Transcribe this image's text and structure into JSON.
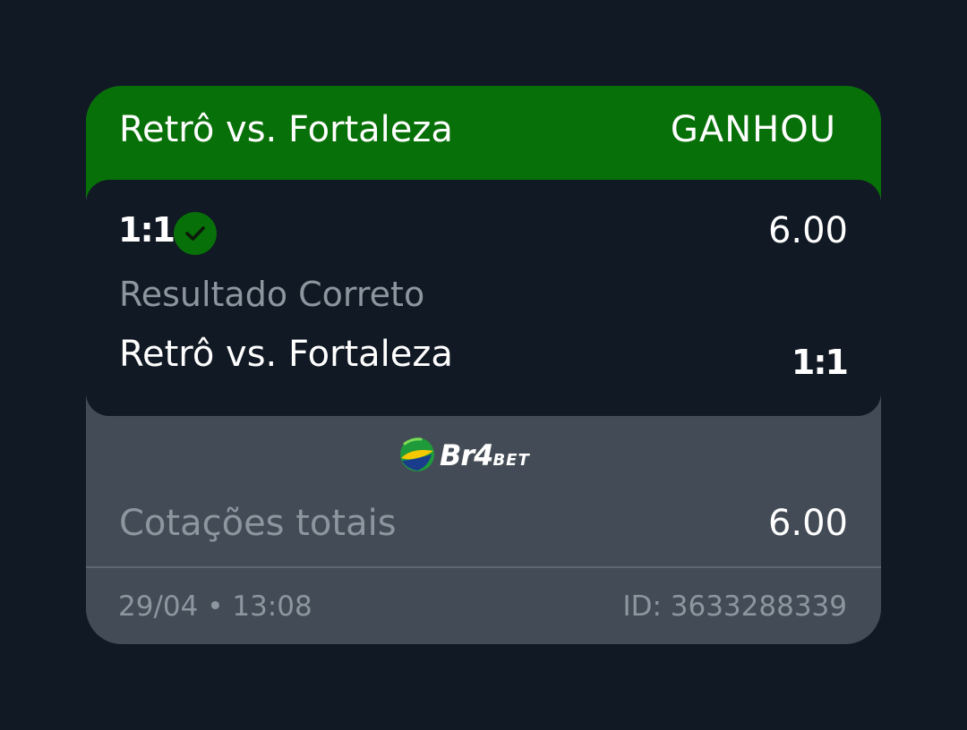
{
  "header": {
    "title": "Retrô vs. Fortaleza",
    "status": "GANHOU"
  },
  "selection": {
    "pick": "1:1",
    "odds": "6.00",
    "market": "Resultado Correto",
    "event": "Retrô vs. Fortaleza",
    "result": "1:1",
    "check_icon": "check-circle-icon"
  },
  "brand": {
    "name_main": "Br4",
    "name_sub": "BET"
  },
  "totals": {
    "label": "Cotações totais",
    "value": "6.00"
  },
  "footer": {
    "date": "29/04",
    "separator": "•",
    "time": "13:08",
    "id": "ID: 3633288339"
  },
  "colors": {
    "background": "#111924",
    "card": "#434c56",
    "win_green": "#087008",
    "muted_text": "#8d959e"
  }
}
